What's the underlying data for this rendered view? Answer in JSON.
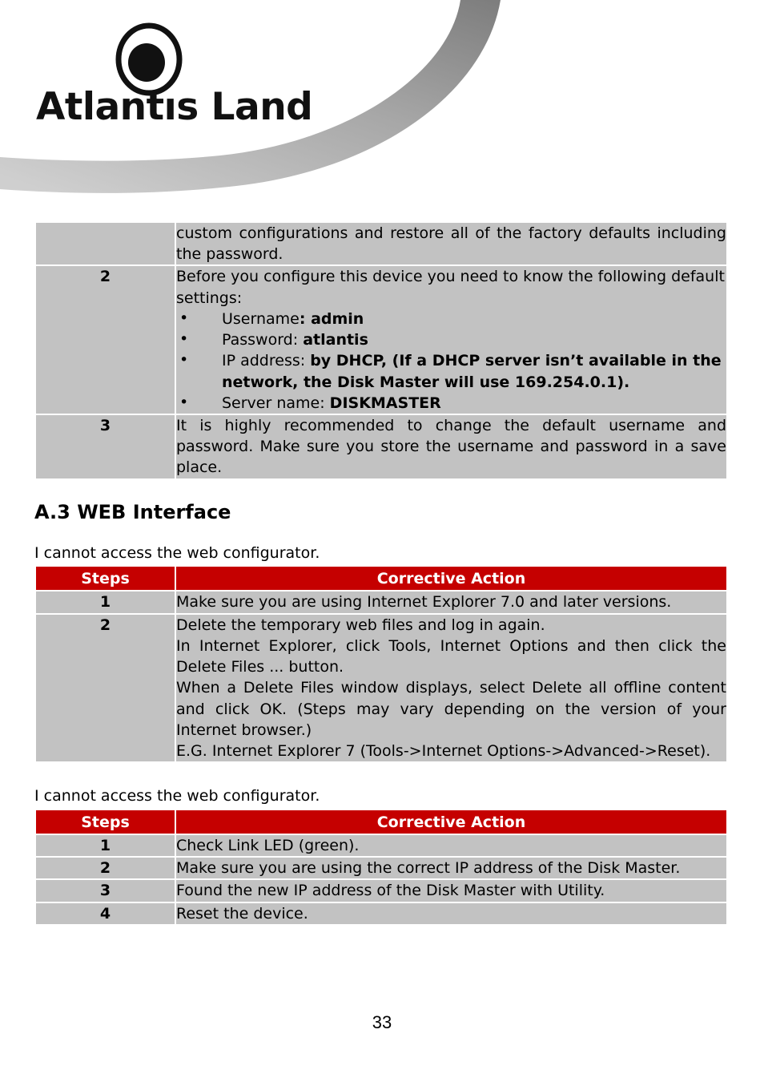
{
  "brand": {
    "logo_wordmark": "Atlantıs Land",
    "logo_icon": "atlantis-eye-logo"
  },
  "table_top": {
    "rows": [
      {
        "step": "",
        "text": "custom configurations and restore all of the factory defaults including the password."
      },
      {
        "step": "2",
        "intro": "Before you configure this device you need to know the following default settings:",
        "bullets": [
          {
            "label": "Username",
            "sep": ": ",
            "value": "admin"
          },
          {
            "label": "Password: ",
            "sep": "",
            "value": "atlantis"
          },
          {
            "label": "IP address: ",
            "sep": "",
            "value": "by DHCP, (If a DHCP server isn’t available in the network, the Disk Master will use 169.254.0.1)."
          },
          {
            "label": "Server name: ",
            "sep": "",
            "value": "DISKMASTER"
          }
        ]
      },
      {
        "step": "3",
        "text": "It is highly recommended to change the default username and password. Make sure you store the username and password in a save place."
      }
    ]
  },
  "section": {
    "heading": "A.3 WEB Interface"
  },
  "block_one": {
    "intro": "I cannot access the web configurator.",
    "headers": {
      "step": "Steps",
      "action": "Corrective Action"
    },
    "rows": [
      {
        "step": "1",
        "lines": [
          "Make sure you are using Internet Explorer 7.0 and later versions."
        ]
      },
      {
        "step": "2",
        "lines": [
          "Delete the temporary web files and log in again.",
          "In Internet Explorer, click Tools, Internet Options and then click the Delete Files ... button.",
          "When a Delete Files window displays, select Delete all offline content and click OK. (Steps may vary depending on the version of your Internet browser.)",
          "E.G. Internet Explorer 7 (Tools->Internet Options->Advanced->Reset)."
        ]
      }
    ]
  },
  "block_two": {
    "intro": "I cannot access the web configurator.",
    "headers": {
      "step": "Steps",
      "action": "Corrective Action"
    },
    "rows": [
      {
        "step": "1",
        "text": "Check Link LED  (green)."
      },
      {
        "step": "2",
        "text": "Make sure you are using the correct IP address of the Disk Master."
      },
      {
        "step": "3",
        "text": "Found the new  IP address of the Disk Master with Utility."
      },
      {
        "step": "4",
        "text": "Reset the device."
      }
    ]
  },
  "footer": {
    "page_number": "33"
  },
  "colors": {
    "table_header_red": "#c50000",
    "table_cell_gray": "#c2c2c2",
    "swoosh_dark": "#777777",
    "swoosh_light": "#c9c9c9"
  }
}
